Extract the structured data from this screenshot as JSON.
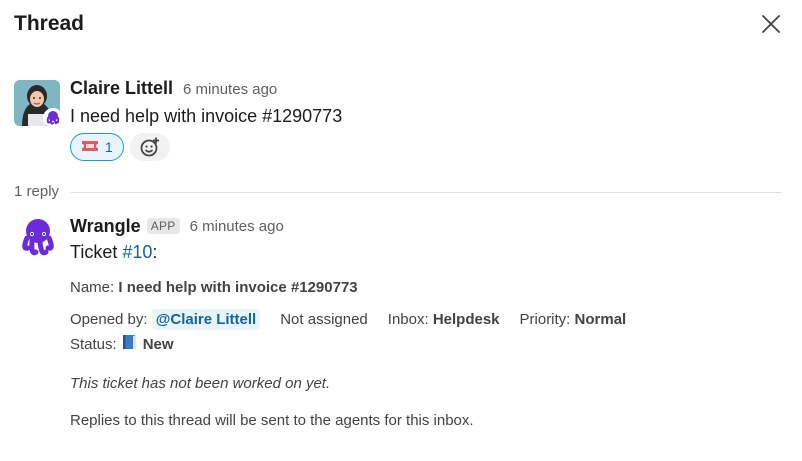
{
  "header": {
    "title": "Thread",
    "close_icon": "close-icon"
  },
  "parent_message": {
    "author": "Claire Littell",
    "time": "6 minutes ago",
    "text": "I need help with invoice #1290773",
    "reactions": [
      {
        "emoji": "ticket",
        "count": "1"
      }
    ],
    "add_reaction_icon": "add-reaction-icon"
  },
  "replies": {
    "count_label": "1 reply"
  },
  "reply_message": {
    "author": "Wrangle",
    "app_tag": "APP",
    "time": "6 minutes ago",
    "ticket_prefix": "Ticket ",
    "ticket_link": "#10",
    "ticket_suffix": ":",
    "name_label": "Name: ",
    "name_value": "I need help with invoice #1290773",
    "opened_by_label": "Opened by: ",
    "opened_by_value": "@Claire Littell",
    "assignment": "Not assigned",
    "inbox_label": "Inbox: ",
    "inbox_value": "Helpdesk",
    "priority_label": "Priority: ",
    "priority_value": "Normal",
    "status_label": "Status: ",
    "status_icon": "blue-book",
    "status_value": "New",
    "note": "This ticket has not been worked on yet.",
    "footer": "Replies to this thread will be sent to the agents for this inbox."
  },
  "colors": {
    "link": "#1264a3",
    "brand": "#6b2bd9"
  }
}
